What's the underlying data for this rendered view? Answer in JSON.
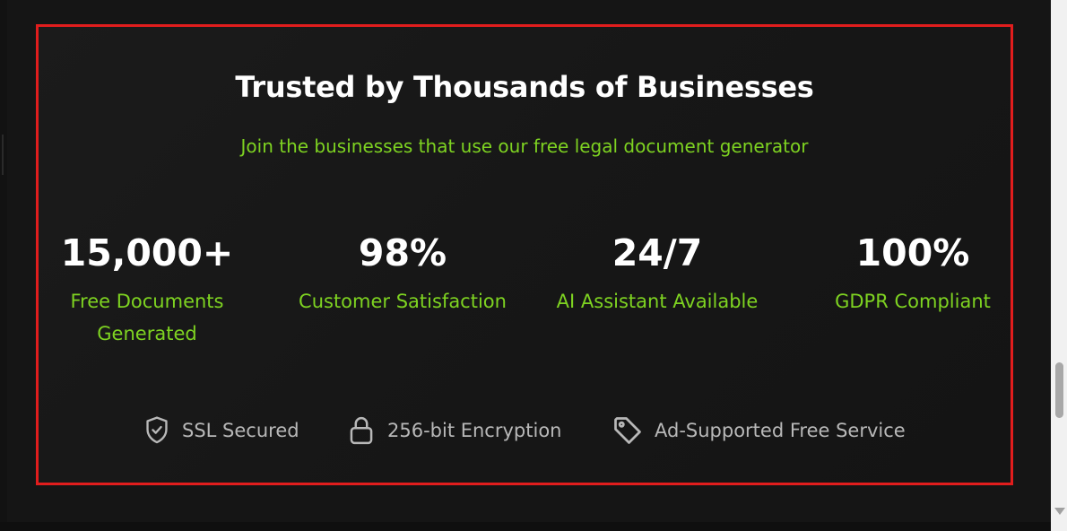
{
  "section": {
    "title": "Trusted by Thousands of Businesses",
    "subtitle": "Join the businesses that use our free legal document generator"
  },
  "stats": [
    {
      "value": "15,000+",
      "label": "Free Documents Generated"
    },
    {
      "value": "98%",
      "label": "Customer Satisfaction"
    },
    {
      "value": "24/7",
      "label": "AI Assistant Available"
    },
    {
      "value": "100%",
      "label": "GDPR Compliant"
    }
  ],
  "badges": [
    {
      "icon": "shield-check-icon",
      "label": "SSL Secured"
    },
    {
      "icon": "lock-icon",
      "label": "256-bit Encryption"
    },
    {
      "icon": "tag-icon",
      "label": "Ad-Supported Free Service"
    }
  ],
  "colors": {
    "accent": "#7ed321",
    "highlight_border": "#e11d1d",
    "background": "#151515"
  }
}
